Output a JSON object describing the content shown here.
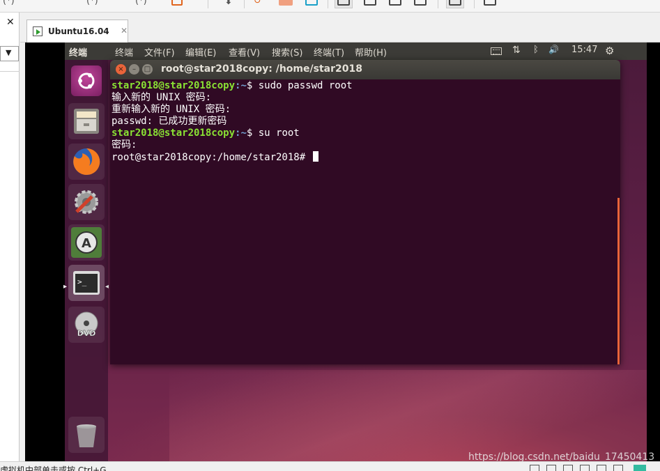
{
  "host": {
    "tab_label": "Ubuntu16.04",
    "tab_close": "✕",
    "left_close": "✕",
    "left_dropdown": "▼",
    "toolbar_glyph": "(*)",
    "status_message": "虚拟机中部单击或按 Ctrl+G"
  },
  "topbar": {
    "app_name": "终端",
    "menus": [
      "终端",
      "文件(F)",
      "编辑(E)",
      "查看(V)",
      "搜索(S)",
      "终端(T)",
      "帮助(H)"
    ],
    "time": "15:47",
    "indicators": {
      "network": "⇅",
      "bluetooth": "ᛒ",
      "volume": "🔊",
      "settings": "⚙"
    }
  },
  "launcher": {
    "items": [
      "ubuntu-dash-icon",
      "files-icon",
      "firefox-icon",
      "system-settings-icon",
      "software-updater-icon",
      "terminal-icon",
      "dvd-icon",
      "trash-icon"
    ]
  },
  "terminal": {
    "title": "root@star2018copy: /home/star2018",
    "buttons": {
      "close": "×",
      "minimize": "–",
      "maximize": "□"
    },
    "lines": [
      {
        "user": "star2018@star2018copy",
        "path": ":~",
        "cmd": "$ sudo passwd root"
      },
      {
        "text": "输入新的 UNIX 密码:"
      },
      {
        "text": "重新输入新的 UNIX 密码:"
      },
      {
        "text": "passwd: 已成功更新密码"
      },
      {
        "user": "star2018@star2018copy",
        "path": ":~",
        "cmd": "$ su root"
      },
      {
        "text": "密码:"
      },
      {
        "text": "root@star2018copy:/home/star2018# "
      }
    ]
  },
  "watermark": "https://blog.csdn.net/baidu_17450413",
  "colors": {
    "terminal_bg": "#300a24",
    "prompt_user": "#8ae234",
    "prompt_path": "#729fcf",
    "accent_orange": "#e9643a"
  }
}
